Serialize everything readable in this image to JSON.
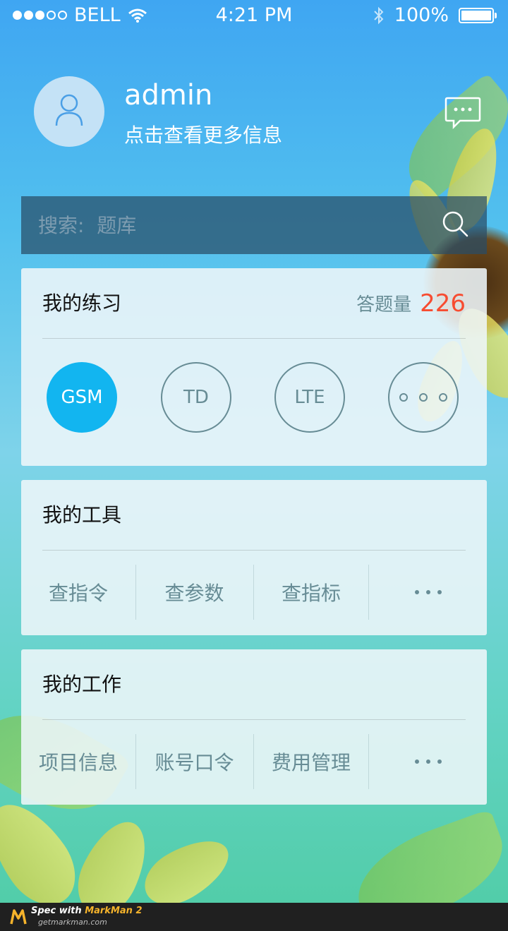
{
  "status_bar": {
    "carrier": "BELL",
    "time": "4:21 PM",
    "battery": "100%"
  },
  "profile": {
    "username": "admin",
    "subtitle": "点击查看更多信息"
  },
  "search": {
    "placeholder": "搜索:  题库"
  },
  "practice": {
    "title": "我的练习",
    "stat_label": "答题量",
    "stat_value": "226",
    "items": [
      "GSM",
      "TD",
      "LTE"
    ]
  },
  "tools": {
    "title": "我的工具",
    "items": [
      "查指令",
      "查参数",
      "查指标"
    ]
  },
  "work": {
    "title": "我的工作",
    "items": [
      "项目信息",
      "账号口令",
      "费用管理"
    ]
  },
  "colors": {
    "accent": "#12b5f0",
    "stat": "#f74c31",
    "muted": "#678c95",
    "title": "#111111"
  },
  "footer": {
    "brand_prefix": "Spec with ",
    "brand_name": "MarkMan 2",
    "url": "getmarkman.com"
  }
}
